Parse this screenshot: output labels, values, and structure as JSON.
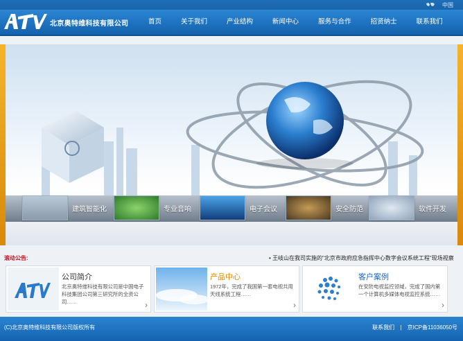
{
  "topbar": {
    "region": "中国",
    "map_icon": "world-map-icon"
  },
  "header": {
    "company": "北京奥特维科技有限公司",
    "logo_text": "ATV"
  },
  "nav": [
    {
      "label": "首页"
    },
    {
      "label": "关于我们"
    },
    {
      "label": "产业结构"
    },
    {
      "label": "新闻中心"
    },
    {
      "label": "服务与合作"
    },
    {
      "label": "招贤纳士"
    },
    {
      "label": "联系我们"
    }
  ],
  "categories": [
    {
      "label": "建筑智能化"
    },
    {
      "label": "专业音响"
    },
    {
      "label": "电子会议"
    },
    {
      "label": "安全防范"
    },
    {
      "label": "软件开发"
    }
  ],
  "notice": {
    "label": "滚动公告:",
    "message": "• 王岐山在我司实施的\"北京市政府应急指挥中心数字会议系统工程\"现场视察"
  },
  "cards": [
    {
      "title": "公司简介",
      "desc": "北京奥特维科技有限公司是中国电子科技集团公司第三研究所的全资公司……",
      "arrow": "›"
    },
    {
      "title": "产品中心",
      "desc": "1972年，完成了我国第一套电视共用天线系统工程……",
      "arrow": "›"
    },
    {
      "title": "客户案例",
      "desc": "在安防电视监控领域，完成了国内第一个计算机多媒体电视监控系统……",
      "arrow": "›"
    }
  ],
  "footer": {
    "copyright": "(C)北京奥特维科技有限公司版权所有",
    "contact": "联系我们",
    "separator": "|",
    "icp": "京ICP备11036050号"
  },
  "colors": {
    "header_blue": "#1e6fb8",
    "accent_red": "#d0101f",
    "product_orange": "#e08a00",
    "case_blue": "#1a66b8",
    "edge_gold": "#f4b42a"
  }
}
